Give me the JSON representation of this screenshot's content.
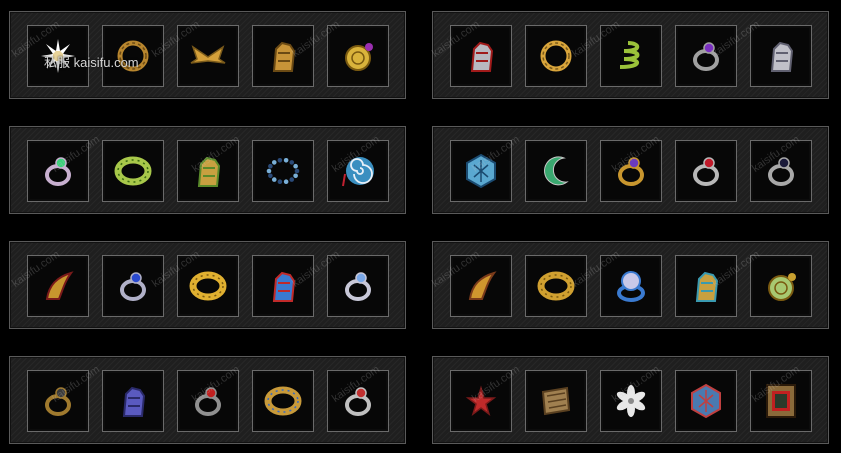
{
  "site_tag": "私服  kaisifu.com",
  "watermark_text": "kaisifu.com",
  "panels": [
    {
      "id": "left-1",
      "items": [
        {
          "icon": "spiked-sun-amulet-icon",
          "color": "#e8d39a",
          "accent": "#ffffff",
          "shape": "sun"
        },
        {
          "icon": "gold-bracelet-icon",
          "color": "#b8862e",
          "accent": "#6b4a14",
          "shape": "ring"
        },
        {
          "icon": "gold-wings-ornament-icon",
          "color": "#d4a03a",
          "accent": "#7a5a1a",
          "shape": "wings"
        },
        {
          "icon": "gold-gauntlet-icon",
          "color": "#c89438",
          "accent": "#6b4a14",
          "shape": "glove"
        },
        {
          "icon": "gold-medallion-icon",
          "color": "#d9b33b",
          "accent": "#9b2fb0",
          "shape": "coin"
        }
      ]
    },
    {
      "id": "right-1",
      "items": [
        {
          "icon": "red-claw-bracer-icon",
          "color": "#b8b8c0",
          "accent": "#a01a1a",
          "shape": "glove"
        },
        {
          "icon": "plain-gold-ring-icon",
          "color": "#d9a53b",
          "accent": "#7a5a1a",
          "shape": "ring"
        },
        {
          "icon": "green-serpent-ring-icon",
          "color": "#9bc23a",
          "accent": "#4a6a10",
          "shape": "coil"
        },
        {
          "icon": "violet-gem-ring-icon",
          "color": "#a0a0a0",
          "accent": "#7a2fc0",
          "shape": "gemring"
        },
        {
          "icon": "silver-hook-bracer-icon",
          "color": "#c0c0c8",
          "accent": "#606070",
          "shape": "glove"
        }
      ]
    },
    {
      "id": "left-2",
      "items": [
        {
          "icon": "serpent-silver-ring-icon",
          "color": "#c8b0d0",
          "accent": "#3ad07a",
          "shape": "gemring"
        },
        {
          "icon": "green-jade-bracelet-icon",
          "color": "#a8c84a",
          "accent": "#3a6a10",
          "shape": "band"
        },
        {
          "icon": "gold-armlet-icon",
          "color": "#c8a040",
          "accent": "#5a8a2a",
          "shape": "glove"
        },
        {
          "icon": "blue-bead-bracelet-icon",
          "color": "#7ab0d8",
          "accent": "#2a4a78",
          "shape": "beads"
        },
        {
          "icon": "blue-spiral-amulet-icon",
          "color": "#3a8fc0",
          "accent": "#c02030",
          "shape": "spiral"
        }
      ]
    },
    {
      "id": "right-2",
      "items": [
        {
          "icon": "blue-rune-bracelet-icon",
          "color": "#5aa8d0",
          "accent": "#1a4a70",
          "shape": "hex"
        },
        {
          "icon": "crescent-jade-ring-icon",
          "color": "#3aa870",
          "accent": "#c8c8c8",
          "shape": "crescent"
        },
        {
          "icon": "purple-gem-gold-ring-icon",
          "color": "#c8962e",
          "accent": "#6a3ac0",
          "shape": "gemring"
        },
        {
          "icon": "ruby-silver-ring-icon",
          "color": "#b8b8b8",
          "accent": "#c01a2a",
          "shape": "gemring"
        },
        {
          "icon": "black-pearl-ring-icon",
          "color": "#a8a8a8",
          "accent": "#1a1a3a",
          "shape": "gemring"
        }
      ]
    },
    {
      "id": "left-3",
      "items": [
        {
          "icon": "gold-horn-talisman-icon",
          "color": "#c8962e",
          "accent": "#7a1a1a",
          "shape": "horn"
        },
        {
          "icon": "sapphire-silver-ring-icon",
          "color": "#b0b0c8",
          "accent": "#2a4ad0",
          "shape": "gemring"
        },
        {
          "icon": "wide-gold-ring-icon",
          "color": "#e0b030",
          "accent": "#7a5a10",
          "shape": "band"
        },
        {
          "icon": "blue-red-bracer-icon",
          "color": "#3a7ad0",
          "accent": "#c02a2a",
          "shape": "glove"
        },
        {
          "icon": "diamond-silver-ring-icon",
          "color": "#c8c8d8",
          "accent": "#7aa8e8",
          "shape": "gemring"
        }
      ]
    },
    {
      "id": "right-3",
      "items": [
        {
          "icon": "gold-claw-talisman-icon",
          "color": "#d0962e",
          "accent": "#7a3a1a",
          "shape": "horn"
        },
        {
          "icon": "gold-cuff-bracelet-icon",
          "color": "#d0a030",
          "accent": "#7a5a10",
          "shape": "band"
        },
        {
          "icon": "blue-orb-ring-icon",
          "color": "#3a7ad0",
          "accent": "#c8c8e8",
          "shape": "orb"
        },
        {
          "icon": "gold-wing-bracer-icon",
          "color": "#c8a040",
          "accent": "#3a9ab0",
          "shape": "glove"
        },
        {
          "icon": "jade-pendant-necklace-icon",
          "color": "#a8c870",
          "accent": "#c8a030",
          "shape": "coin"
        }
      ]
    },
    {
      "id": "left-4",
      "items": [
        {
          "icon": "dark-gold-ring-icon",
          "color": "#a07a2e",
          "accent": "#3a3a3a",
          "shape": "gemring"
        },
        {
          "icon": "violet-dragon-bracer-icon",
          "color": "#5a5ac0",
          "accent": "#2a2a6a",
          "shape": "glove"
        },
        {
          "icon": "ruby-dark-ring-icon",
          "color": "#909090",
          "accent": "#c02020",
          "shape": "gemring"
        },
        {
          "icon": "gold-gem-bracelet-icon",
          "color": "#c89a3a",
          "accent": "#3a6ac0",
          "shape": "band"
        },
        {
          "icon": "red-stone-silver-ring-icon",
          "color": "#c0c0c0",
          "accent": "#c03030",
          "shape": "gemring"
        }
      ]
    },
    {
      "id": "right-4",
      "items": [
        {
          "icon": "red-star-charm-icon",
          "color": "#c02a2a",
          "accent": "#7a1a1a",
          "shape": "star"
        },
        {
          "icon": "ancient-scroll-icon",
          "color": "#a08050",
          "accent": "#5a4020",
          "shape": "scroll"
        },
        {
          "icon": "white-flower-icon",
          "color": "#e8e8e8",
          "accent": "#8a8a8a",
          "shape": "flower"
        },
        {
          "icon": "blue-rune-stone-icon",
          "color": "#4a7ab0",
          "accent": "#c04040",
          "shape": "hex"
        },
        {
          "icon": "red-relic-tablet-icon",
          "color": "#8a6a3a",
          "accent": "#c02020",
          "shape": "tablet"
        }
      ]
    }
  ]
}
